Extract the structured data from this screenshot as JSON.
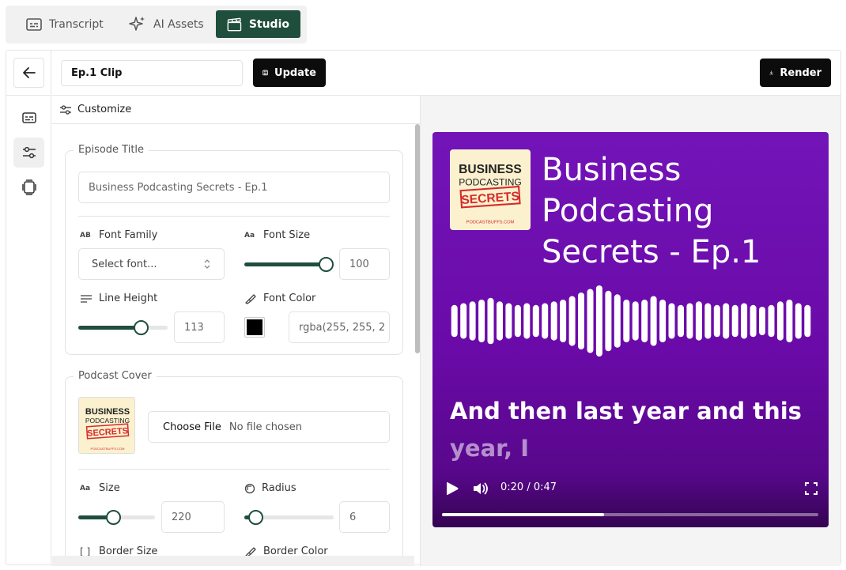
{
  "tabs": [
    {
      "label": "Transcript",
      "icon": "transcript-icon"
    },
    {
      "label": "AI Assets",
      "icon": "sparkles-icon"
    },
    {
      "label": "Studio",
      "icon": "clapperboard-icon"
    }
  ],
  "header": {
    "clip_name": "Ep.1 Clip",
    "update_label": "Update",
    "render_label": "Render"
  },
  "panel": {
    "title": "Customize",
    "episode_title": {
      "legend": "Episode Title",
      "value": "Business Podcasting Secrets - Ep.1",
      "font_family_label": "Font Family",
      "font_family_ico": "AB",
      "font_family_placeholder": "Select font...",
      "font_size_label": "Font Size",
      "font_size_ico": "Aa",
      "font_size_value": "100",
      "font_size_level": 1.0,
      "line_height_label": "Line Height",
      "line_height_value": "113",
      "line_height_level": 0.7,
      "font_color_label": "Font Color",
      "font_color_swatch": "#000000",
      "font_color_value": "rgba(255, 255, 2"
    },
    "podcast_cover": {
      "legend": "Podcast Cover",
      "choose_file_label": "Choose File",
      "no_file_label": "No file chosen",
      "size_label": "Size",
      "size_ico": "Aa",
      "size_value": "220",
      "size_level": 0.45,
      "radius_label": "Radius",
      "radius_value": "6",
      "radius_level": 0.12,
      "border_size_label": "Border Size",
      "border_color_label": "Border Color"
    }
  },
  "cover_art": {
    "line1": "BUSINESS",
    "line2": "PODCASTING",
    "line3": "SECRETS",
    "footer": "PODCASTBUFFS.COM"
  },
  "preview": {
    "title": "Business Podcasting Secrets - Ep.1",
    "caption_bright": "And then last year and this",
    "caption_dim": "year, I",
    "time": "0:20 / 0:47",
    "progress": 0.43,
    "wave_levels": [
      0.45,
      0.5,
      0.55,
      0.6,
      0.65,
      0.55,
      0.5,
      0.45,
      0.5,
      0.45,
      0.5,
      0.55,
      0.6,
      0.7,
      0.8,
      0.9,
      1.0,
      0.85,
      0.75,
      0.6,
      0.55,
      0.6,
      0.7,
      0.6,
      0.5,
      0.45,
      0.5,
      0.55,
      0.5,
      0.45,
      0.5,
      0.45,
      0.5,
      0.45,
      0.4,
      0.45,
      0.55,
      0.6,
      0.5,
      0.45
    ],
    "accent": "#7214b8"
  },
  "colors": {
    "brand": "#1f4e3d",
    "dark_button": "#0c0c0c"
  }
}
